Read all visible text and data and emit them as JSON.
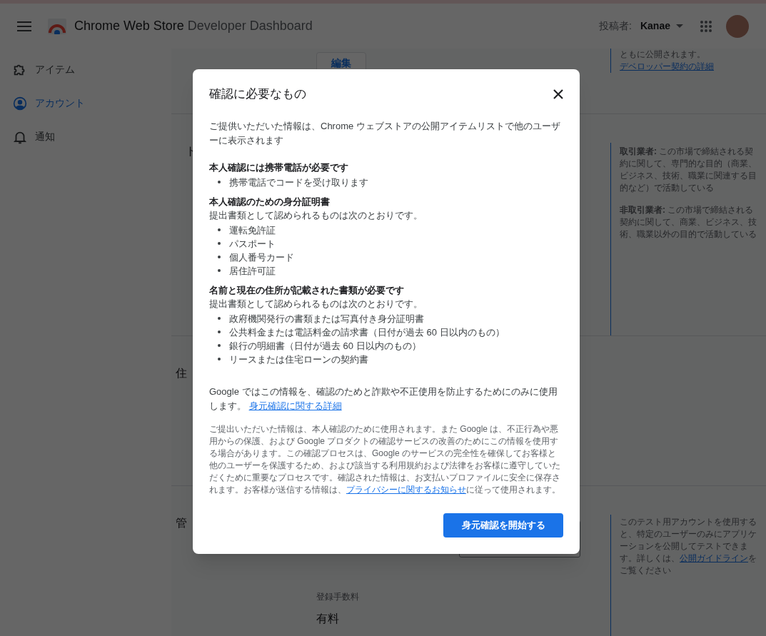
{
  "header": {
    "product": "Chrome Web Store",
    "subtitle": "Developer Dashboard",
    "publisher_label": "投稿者:",
    "publisher": "Kanae"
  },
  "sidebar": {
    "items": [
      {
        "label": "アイテム",
        "selected": false
      },
      {
        "label": "アカウント",
        "selected": true
      },
      {
        "label": "通知",
        "selected": false
      }
    ]
  },
  "background": {
    "section_1": {
      "edit_button": "編集",
      "note": "ともに公開されます。",
      "note_link": "デベロッパー契約の詳細"
    },
    "section_2": {
      "title": "ト",
      "notes": [
        "**取引業者:** この市場で締結される契約に関して、専門的な目的（商業、ビジネス、技術、職業に関連する目的など）で活動している",
        "**非取引業者:** この市場で締結される契約に関して、商業、ビジネス、技術、職業以外の目的で活動している"
      ]
    },
    "section_3": {
      "title": "住"
    },
    "section_4": {
      "title": "管",
      "note": "このテスト用アカウントを使用すると、特定のユーザーのみにアプリケーションを公開してテストできます。詳しくは、",
      "note_link": "公開ガイドライン",
      "note_tail": "をご覧ください",
      "fee_label": "登録手数料",
      "fee_value": "有料"
    }
  },
  "dialog": {
    "title": "確認に必要なもの",
    "intro": "ご提供いただいた情報は、Chrome ウェブストアの公開アイテムリストで他のユーザーに表示されます",
    "groups": [
      {
        "heading": "本人確認には携帯電話が必要です",
        "items": [
          "携帯電話でコードを受け取ります"
        ]
      },
      {
        "heading": "本人確認のための身分証明書",
        "description": "提出書類として認められるものは次のとおりです。",
        "items": [
          "運転免許証",
          "パスポート",
          "個人番号カード",
          "居住許可証"
        ]
      },
      {
        "heading": "名前と現在の住所が記載された書類が必要です",
        "description": "提出書類として認められるものは次のとおりです。",
        "items": [
          "政府機関発行の書類または写真付き身分証明書",
          "公共料金または電話料金の請求書（日付が過去 60 日以内のもの）",
          "銀行の明細書（日付が過去 60 日以内のもの）",
          "リースまたは住宅ローンの契約書"
        ]
      }
    ],
    "notice": "Google ではこの情報を、確認のためと詐欺や不正使用を防止するためにのみに使用します。",
    "notice_link": "身元確認に関する詳細",
    "fine_print": "ご提出いただいた情報は、本人確認のために使用されます。また Google は、不正行為や悪用からの保護、および Google プロダクトの確認サービスの改善のためにこの情報を使用する場合があります。この確認プロセスは、Google のサービスの完全性を確保してお客様と他のユーザーを保護するため、および該当する利用規約および法律をお客様に遵守していただくために重要なプロセスです。確認された情報は、お支払いプロファイルに安全に保存されます。お客様が送信する情報は、",
    "fine_print_link": "プライバシーに関するお知らせ",
    "fine_print_tail": "に従って使用されます。",
    "primary_button": "身元確認を開始する"
  }
}
